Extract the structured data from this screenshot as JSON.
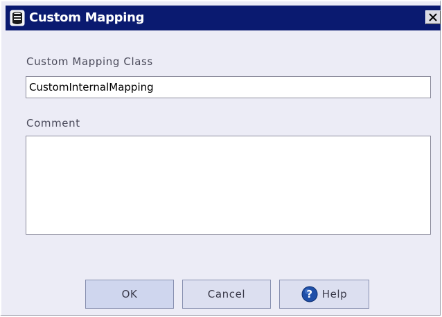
{
  "dialog": {
    "title": "Custom Mapping",
    "title_icon": "database-icon",
    "close_icon": "close-icon",
    "colors": {
      "titlebar": "#0a1a70",
      "background": "#ececf6",
      "ok_button": "#cfd6ee",
      "help_icon": "#1f4fa8"
    }
  },
  "fields": {
    "class_label": "Custom Mapping Class",
    "class_value": "CustomInternalMapping",
    "comment_label": "Comment",
    "comment_value": ""
  },
  "buttons": {
    "ok_label": "OK",
    "cancel_label": "Cancel",
    "help_label": "Help",
    "help_icon": "help-icon"
  }
}
